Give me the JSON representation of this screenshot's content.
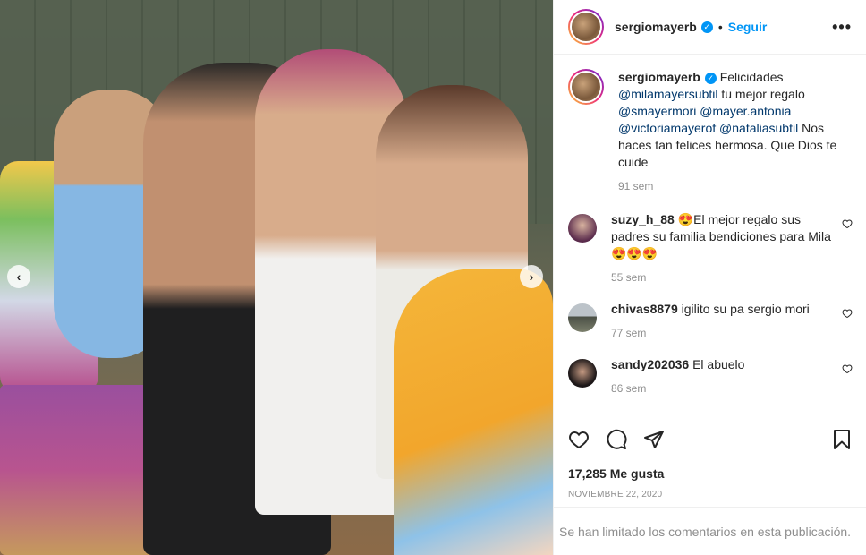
{
  "post": {
    "username": "sergiomayerb",
    "follow_label": "Seguir",
    "separator": "•",
    "more_label": "•••",
    "verified_mark": "✓",
    "caption": {
      "text_start": "Felicidades",
      "mention1": "@milamayersubtil",
      "text_mid": "tu mejor regalo",
      "mention2": "@smayermori",
      "mention3": "@mayer.antonia",
      "mention4": "@victoriamayerof",
      "mention5": "@nataliasubtil",
      "text_end": "Nos haces tan felices hermosa. Que Dios te cuide",
      "time": "91 sem"
    }
  },
  "comments": [
    {
      "user": "suzy_h_88",
      "text": "😍El mejor regalo sus padres su familia bendiciones para Mila 😍😍😍",
      "time": "55 sem"
    },
    {
      "user": "chivas8879",
      "text": "igilito su pa sergio mori",
      "time": "77 sem"
    },
    {
      "user": "sandy202036",
      "text": "El abuelo",
      "time": "86 sem"
    }
  ],
  "footer": {
    "likes": "17,285 Me gusta",
    "date": "NOVIEMBRE 22, 2020",
    "limited_text": "Se han limitado los comentarios en esta publicación."
  },
  "carousel": {
    "prev_label": "‹",
    "next_label": "›"
  },
  "icons": {
    "like": "heart-icon",
    "comment": "comment-icon",
    "share": "share-icon",
    "save": "bookmark-icon",
    "comment_like": "heart-outline-icon",
    "nav_prev": "chevron-left-icon",
    "nav_next": "chevron-right-icon"
  },
  "colors": {
    "accent": "#0095f6",
    "mention": "#00376b",
    "muted": "#8e8e8e",
    "text": "#262626"
  }
}
